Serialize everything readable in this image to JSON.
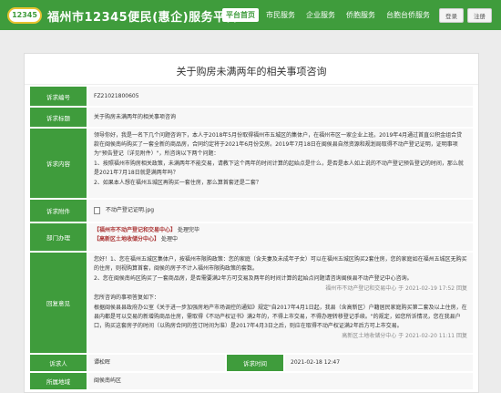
{
  "header": {
    "logo_text": "12345",
    "site_title": "福州市12345便民(惠企)服务平台",
    "nav": [
      "平台首页",
      "市民服务",
      "企业服务",
      "侨胞服务",
      "台胞台侨服务"
    ],
    "login": "登录",
    "register": "注册"
  },
  "page_title": "关于购房未满两年的相关事项咨询",
  "labels": {
    "number": "诉求编号",
    "title": "诉求标题",
    "content": "诉求内容",
    "attachment": "诉求附件",
    "department": "部门办理",
    "reply": "回复意见",
    "requester": "诉求人",
    "time": "诉求时间",
    "area": "所属地域"
  },
  "values": {
    "number": "FZ21021800605",
    "title": "关于购房未满两年的相关事项咨询",
    "content": [
      "领导你好，我是一名下几个问题咨询下，本人于2018年5月份取得福州市五城区的集体户，在福州市区一家企业上班。2019年4月通过首直公积金组合贷款在闽侯南屿购买了一套全新的商品房，合同约定将于2021年6月份交房。2019年7月18日在闽侯县自然资源和规划局取得不动产登记证明，证明事项为\"预告登记（详见附件）\"，所咨询以下两个问题：",
      "1、按照福州市购房相关政策，未满两年不能交易，请教下这个两年的时间计算的起始点是什么，是否是本人如上说的不动产登记预告登记的时间，那么就是2021年7月18日就是满两年吗？",
      "2、如果本人想在福州五城区再购买一套住房，那么算首套还是二套？"
    ],
    "attachment": "不动产登记证明.jpg",
    "departments": [
      {
        "name": "【福州市不动产登记和交易中心】",
        "status": "处理完毕"
      },
      {
        "name": "【高新区土地收储分中心】",
        "status": "处理中"
      }
    ],
    "reply_1": [
      "您好！1、您在福州五城区集体户，按福州市限购政策：您的家庭（含夫妻及未成年子女）可以在福州五城区购买2套住房，您的家庭如在福州五城区无购买的住房，则视购算首套，闽侯的房子不计入福州市限购政策的套数。",
      "2、您在闽侯南屿区购买了一套商品房，是否需要满2年方可交易及两年的时间计算的起始点问题请咨询闽侯县不动产登记中心咨询。"
    ],
    "reply_1_meta": "福州市不动产登记和交易中心 于 2021-02-19 17:52 回复",
    "reply_2": [
      "您所咨询的事项答复如下：",
      "根据闽侯县县政府办公室《关于进一步加强房地产市场调控的通知》规定\"自2017年4月1日起，我县（含高新区）户籍居民家庭购买第二套及以上住房，在县内都是可以交易的新增购商品住房，需取得《不动产权证书》满2年的，不得上市交易，不得办理转移登记手续。\"的规定，如您所诉情况，您在我县户口，购买这套房子的时间（以购房合同的签订时间为准）是2017年4月3日之后，则应在取得不动产权证满2年后方可上市交易。"
    ],
    "reply_2_meta": "高新区土地收储分中心 于 2021-02-20 11:11 回复",
    "requester": "谭松晖",
    "time": "2021-02-18 12:47",
    "area": "闽侯南屿区"
  }
}
